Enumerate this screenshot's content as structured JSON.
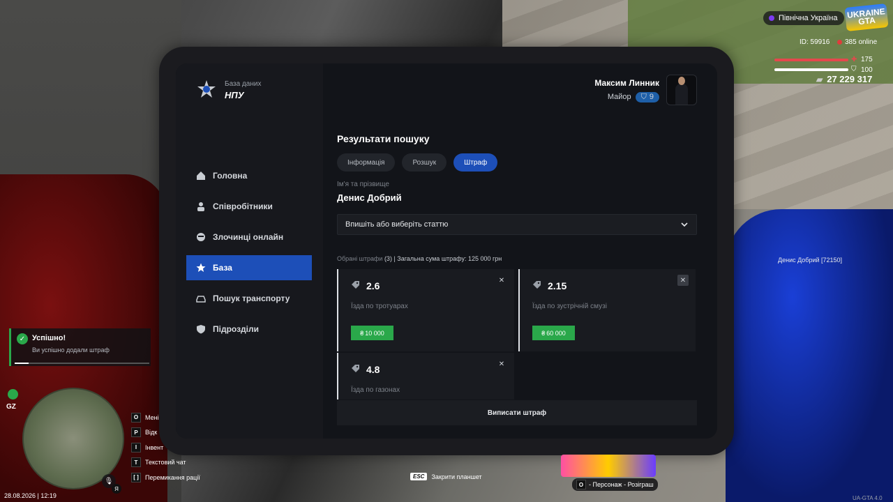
{
  "hud": {
    "server_name": "Північна Україна",
    "logo_text": "UKRAINE GTA",
    "player_id": "ID: 59916",
    "online": "385 online",
    "health": "175",
    "armor": "100",
    "money": "27 229 317",
    "health_level_pct": 100,
    "armor_level_pct": 100
  },
  "tablet": {
    "brand": {
      "subtitle": "База даних",
      "title": "НПУ"
    },
    "user": {
      "name": "Максим Линник",
      "rank": "Майор",
      "level": "9"
    },
    "nav": [
      {
        "label": "Головна",
        "icon": "home-icon",
        "active": false
      },
      {
        "label": "Співробітники",
        "icon": "users-icon",
        "active": false
      },
      {
        "label": "Злочинці онлайн",
        "icon": "criminal-icon",
        "active": false
      },
      {
        "label": "База",
        "icon": "star-icon",
        "active": true
      },
      {
        "label": "Пошук транспорту",
        "icon": "car-icon",
        "active": false
      },
      {
        "label": "Підрозділи",
        "icon": "shield-icon",
        "active": false
      }
    ],
    "results_title": "Результати пошуку",
    "tabs": [
      {
        "label": "Інформація",
        "active": false
      },
      {
        "label": "Розшук",
        "active": false
      },
      {
        "label": "Штраф",
        "active": true
      }
    ],
    "name_label": "Ім'я та прізвище",
    "person_name": "Денис Добрий",
    "select_placeholder": "Впишіть або виберіть статтю",
    "summary_prefix": "Обрані штрафи",
    "summary_rest": "(3) | Загальна сума штрафу: 125 000 грн",
    "fines": [
      {
        "code": "2.6",
        "desc": "Їзда по тротуарах",
        "price": "10 000"
      },
      {
        "code": "2.15",
        "desc": "Їзда по зустрічній смузі",
        "price": "60 000"
      },
      {
        "code": "4.8",
        "desc": "Їзда по газонах",
        "price": ""
      }
    ],
    "issue_button": "Виписати штраф"
  },
  "toast": {
    "title": "Успішно!",
    "text": "Ви успішно додали штраф",
    "progress_pct": 10
  },
  "gz_label": "GZ",
  "keys": [
    {
      "key": "O",
      "label": "Мені"
    },
    {
      "key": "P",
      "label": "Відк"
    },
    {
      "key": "I",
      "label": "Інвент"
    },
    {
      "key": "T",
      "label": "Текстовий чат"
    },
    {
      "key": "[ ]",
      "label": "Перемикання рації"
    }
  ],
  "mic_key": "Я",
  "datetime": "28.08.2026 | 12:19",
  "esc_hint": {
    "key": "ESC",
    "label": "Закрити планшет"
  },
  "promo": {
    "key": "O",
    "label": "- Персонаж - Розіграш"
  },
  "npc_tag": "Денис Добрий [72150]",
  "version": "UA-GTA 4.0",
  "colors": {
    "accent": "#1d4fb8",
    "price_green": "#2aa84a"
  }
}
